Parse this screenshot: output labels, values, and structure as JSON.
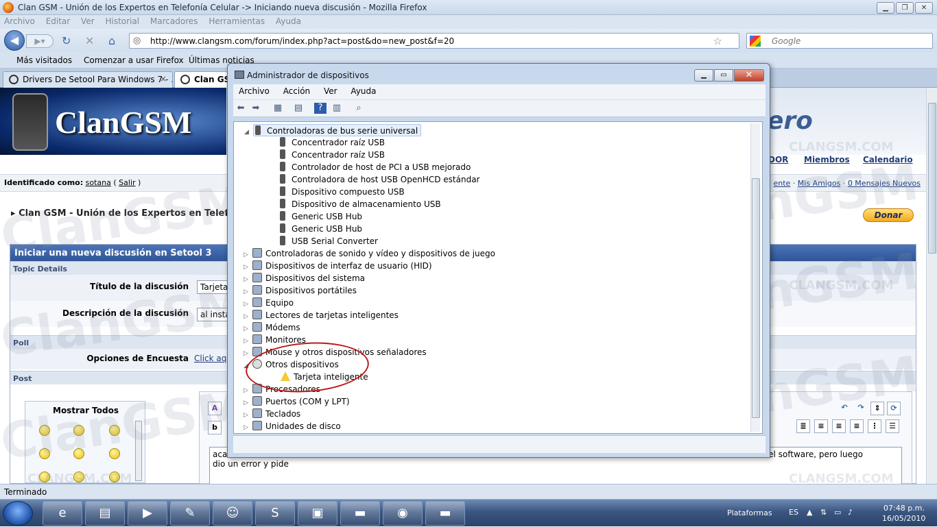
{
  "firefox": {
    "window_title": "Clan GSM - Unión de los Expertos en Telefonía Celular -> Iniciando nueva discusión - Mozilla Firefox",
    "menu": [
      "Archivo",
      "Editar",
      "Ver",
      "Historial",
      "Marcadores",
      "Herramientas",
      "Ayuda"
    ],
    "url": "http://www.clangsm.com/forum/index.php?act=post&do=new_post&f=20",
    "search_placeholder": "Google",
    "bookmarks": [
      "Más visitados",
      "Comenzar a usar Firefox",
      "Últimas noticias"
    ],
    "tabs": [
      {
        "label": "Drivers De Setool Para Windows 7 - ...",
        "close": "×"
      },
      {
        "label": "Clan GSM"
      }
    ],
    "status": "Terminado"
  },
  "forum": {
    "logo_text": "ClanGSM",
    "logo_fragment": "ero",
    "nav": [
      "DOR",
      "Miembros",
      "Calendario"
    ],
    "user": {
      "prefix": "Identificado como:",
      "name": "sotana",
      "logout": "Salir"
    },
    "user_links": [
      "ente",
      "Mis Amigos",
      "0 Mensajes Nuevos"
    ],
    "breadcrumb": "Clan GSM - Unión de los Expertos en Telefoní",
    "donate": "Donar",
    "form": {
      "header": "Iniciar una nueva discusión en Setool 3",
      "topic_details": "Topic Details",
      "title_label": "Título de la discusión",
      "title_value": "Tarjeta",
      "desc_label": "Descripción de la discusión",
      "desc_value": "al insta",
      "poll": "Poll",
      "poll_label": "Opciones de Encuesta",
      "poll_link": "Click aq",
      "post": "Post",
      "emoticons_title": "Mostrar Todos",
      "post_text_left": "aca",
      "post_text_right": "rrio el software, pero luego",
      "post_text_line2": "dio un error y pide"
    },
    "watermark": "ClanGSM",
    "watermark_small": "CLANGSM.COM"
  },
  "device_manager": {
    "title": "Administrador de dispositivos",
    "menu": [
      "Archivo",
      "Acción",
      "Ver",
      "Ayuda"
    ],
    "usb_category": "Controladoras de bus serie universal",
    "usb_children": [
      "Concentrador raíz USB",
      "Concentrador raíz USB",
      "Controlador de host de PCI a USB mejorado",
      "Controladora de host USB OpenHCD estándar",
      "Dispositivo compuesto USB",
      "Dispositivo de almacenamiento USB",
      "Generic USB Hub",
      "Generic USB Hub",
      "USB Serial Converter"
    ],
    "categories_before": [
      "Controladoras de sonido y vídeo y dispositivos de juego",
      "Dispositivos de interfaz de usuario (HID)",
      "Dispositivos del sistema",
      "Dispositivos portátiles",
      "Equipo",
      "Lectores de tarjetas inteligentes",
      "Módems",
      "Monitores",
      "Mouse y otros dispositivos señaladores"
    ],
    "other_devices": "Otros dispositivos",
    "other_child": "Tarjeta inteligente",
    "categories_after": [
      "Procesadores",
      "Puertos (COM y LPT)",
      "Teclados",
      "Unidades de disco"
    ]
  },
  "taskbar": {
    "tray_label": "Plataformas",
    "lang": "ES",
    "time": "07:48 p.m.",
    "date": "16/05/2010"
  }
}
